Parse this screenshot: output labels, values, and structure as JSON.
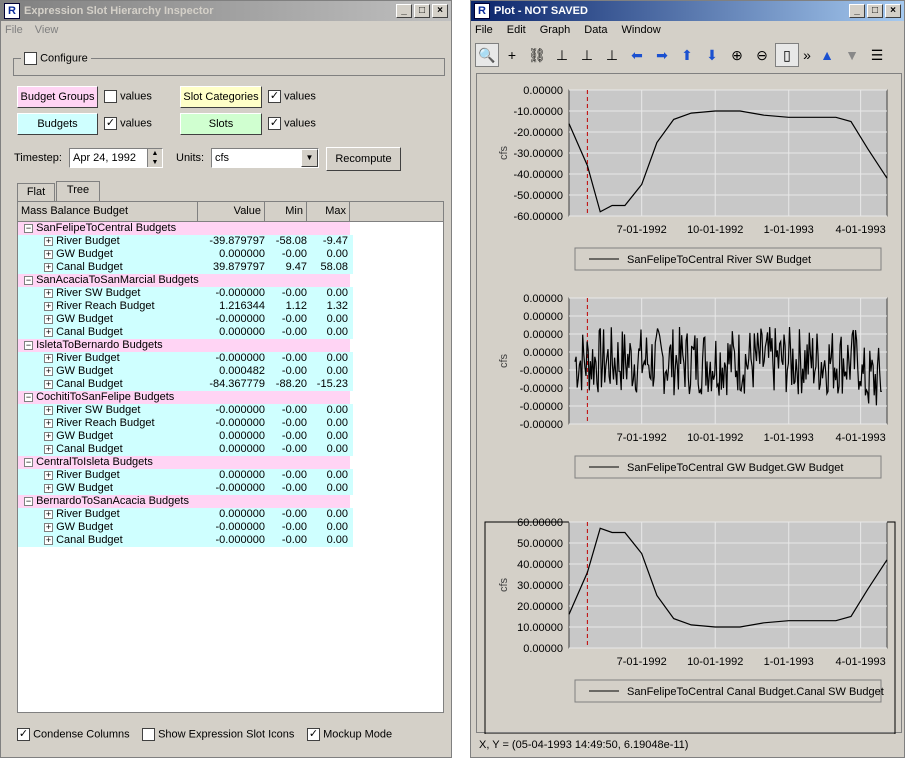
{
  "left": {
    "title": "Expression Slot Hierarchy Inspector",
    "menu": [
      "File",
      "View"
    ],
    "configure_label": "Configure",
    "budget_groups": "Budget Groups",
    "budgets": "Budgets",
    "slot_categories": "Slot Categories",
    "slots": "Slots",
    "values_label": "values",
    "timestep_label": "Timestep:",
    "timestep_value": "Apr 24, 1992",
    "units_label": "Units:",
    "units_value": "cfs",
    "recompute": "Recompute",
    "tabs": [
      "Flat",
      "Tree"
    ],
    "columns": [
      "Mass Balance Budget",
      "Value",
      "Min",
      "Max"
    ],
    "groups": [
      {
        "name": "SanFelipeToCentral Budgets",
        "items": [
          {
            "name": "River Budget",
            "value": "-39.879797",
            "min": "-58.08",
            "max": "-9.47"
          },
          {
            "name": "GW Budget",
            "value": "0.000000",
            "min": "-0.00",
            "max": "0.00"
          },
          {
            "name": "Canal Budget",
            "value": "39.879797",
            "min": "9.47",
            "max": "58.08"
          }
        ]
      },
      {
        "name": "SanAcaciaToSanMarcial Budgets",
        "items": [
          {
            "name": "River SW Budget",
            "value": "-0.000000",
            "min": "-0.00",
            "max": "0.00"
          },
          {
            "name": "River Reach Budget",
            "value": "1.216344",
            "min": "1.12",
            "max": "1.32"
          },
          {
            "name": "GW Budget",
            "value": "-0.000000",
            "min": "-0.00",
            "max": "0.00"
          },
          {
            "name": "Canal Budget",
            "value": "0.000000",
            "min": "-0.00",
            "max": "0.00"
          }
        ]
      },
      {
        "name": "IsletaToBernardo Budgets",
        "items": [
          {
            "name": "River Budget",
            "value": "-0.000000",
            "min": "-0.00",
            "max": "0.00"
          },
          {
            "name": "GW Budget",
            "value": "0.000482",
            "min": "-0.00",
            "max": "0.00"
          },
          {
            "name": "Canal Budget",
            "value": "-84.367779",
            "min": "-88.20",
            "max": "-15.23"
          }
        ]
      },
      {
        "name": "CochitiToSanFelipe Budgets",
        "items": [
          {
            "name": "River SW Budget",
            "value": "-0.000000",
            "min": "-0.00",
            "max": "0.00"
          },
          {
            "name": "River Reach Budget",
            "value": "-0.000000",
            "min": "-0.00",
            "max": "0.00"
          },
          {
            "name": "GW Budget",
            "value": "0.000000",
            "min": "-0.00",
            "max": "0.00"
          },
          {
            "name": "Canal Budget",
            "value": "0.000000",
            "min": "-0.00",
            "max": "0.00"
          }
        ]
      },
      {
        "name": "CentralToIsleta Budgets",
        "items": [
          {
            "name": "River Budget",
            "value": "0.000000",
            "min": "-0.00",
            "max": "0.00"
          },
          {
            "name": "GW Budget",
            "value": "-0.000000",
            "min": "-0.00",
            "max": "0.00"
          }
        ]
      },
      {
        "name": "BernardoToSanAcacia Budgets",
        "items": [
          {
            "name": "River Budget",
            "value": "0.000000",
            "min": "-0.00",
            "max": "0.00"
          },
          {
            "name": "GW Budget",
            "value": "-0.000000",
            "min": "-0.00",
            "max": "0.00"
          },
          {
            "name": "Canal Budget",
            "value": "-0.000000",
            "min": "-0.00",
            "max": "0.00"
          }
        ]
      }
    ],
    "condense_columns": "Condense Columns",
    "show_icons": "Show Expression Slot Icons",
    "mockup_mode": "Mockup Mode"
  },
  "right": {
    "title": "Plot - NOT SAVED",
    "menu": [
      "File",
      "Edit",
      "Graph",
      "Data",
      "Window"
    ],
    "status": "X, Y = (05-04-1993 14:49:50, 6.19048e-11)",
    "ylabel": "cfs",
    "x_ticks": [
      "7-01-1992",
      "10-01-1992",
      "1-01-1993",
      "4-01-1993"
    ]
  },
  "chart_data": [
    {
      "type": "line",
      "legend": "SanFelipeToCentral River SW Budget",
      "ylabel": "cfs",
      "y_ticks": [
        "0.00000",
        "-10.00000",
        "-20.00000",
        "-30.00000",
        "-40.00000",
        "-50.00000",
        "-60.00000"
      ],
      "ylim": [
        -60,
        0
      ],
      "x_ticks": [
        "7-01-1992",
        "10-01-1992",
        "1-01-1993",
        "4-01-1993"
      ],
      "x": [
        "1992-04-01",
        "1992-04-24",
        "1992-05-10",
        "1992-05-25",
        "1992-06-10",
        "1992-07-01",
        "1992-07-20",
        "1992-08-10",
        "1992-09-01",
        "1992-10-01",
        "1992-11-01",
        "1992-12-01",
        "1993-01-01",
        "1993-02-01",
        "1993-03-01",
        "1993-03-20",
        "1993-04-10",
        "1993-05-04"
      ],
      "values": [
        -16,
        -36,
        -58,
        -55,
        -55,
        -45,
        -25,
        -14,
        -11,
        -10,
        -10,
        -12,
        -13,
        -13,
        -13,
        -15,
        -28,
        -42
      ],
      "marker_x": "1992-04-24"
    },
    {
      "type": "line",
      "legend": "SanFelipeToCentral GW Budget.GW Budget",
      "ylabel": "cfs",
      "y_ticks": [
        "0.00000",
        "0.00000",
        "0.00000",
        "0.00000",
        "-0.00000",
        "-0.00000",
        "-0.00000",
        "-0.00000"
      ],
      "ylim": [
        -1,
        1
      ],
      "x_ticks": [
        "7-01-1992",
        "10-01-1992",
        "1-01-1993",
        "4-01-1993"
      ],
      "noise": true,
      "marker_x": "1992-04-24"
    },
    {
      "type": "line",
      "legend": "SanFelipeToCentral Canal Budget.Canal SW Budget",
      "ylabel": "cfs",
      "y_ticks": [
        "60.00000",
        "50.00000",
        "40.00000",
        "30.00000",
        "20.00000",
        "10.00000",
        "0.00000"
      ],
      "ylim": [
        0,
        60
      ],
      "x_ticks": [
        "7-01-1992",
        "10-01-1992",
        "1-01-1993",
        "4-01-1993"
      ],
      "x": [
        "1992-04-01",
        "1992-04-24",
        "1992-05-10",
        "1992-05-25",
        "1992-06-10",
        "1992-07-01",
        "1992-07-20",
        "1992-08-10",
        "1992-09-01",
        "1992-10-01",
        "1992-11-01",
        "1992-12-01",
        "1993-01-01",
        "1993-02-01",
        "1993-03-01",
        "1993-03-20",
        "1993-04-10",
        "1993-05-04"
      ],
      "values": [
        16,
        36,
        57,
        55,
        55,
        45,
        25,
        14,
        11,
        10,
        10,
        12,
        13,
        13,
        13,
        15,
        28,
        42
      ],
      "marker_x": "1992-04-24"
    }
  ]
}
